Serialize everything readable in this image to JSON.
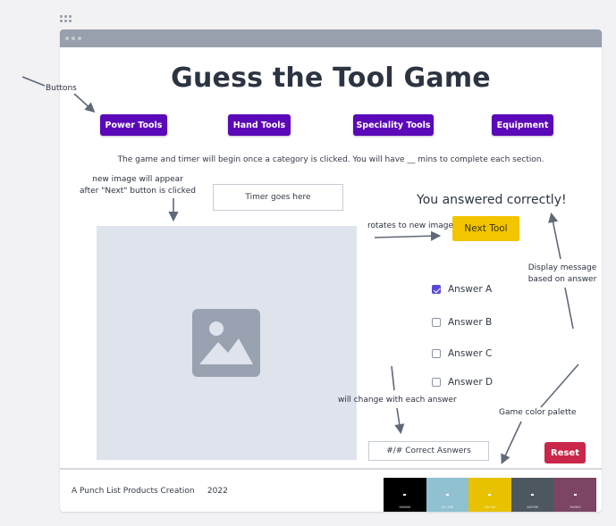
{
  "game": {
    "title": "Guess the Tool Game",
    "categories": [
      "Power Tools",
      "Hand Tools",
      "Speciality Tools",
      "Equipment"
    ],
    "instructions": "The game and timer will begin once a category is clicked. You will have __ mins to complete each section.",
    "timer_placeholder": "Timer goes here",
    "feedback_message": "You answered correctly!",
    "next_button": "Next Tool",
    "answers": [
      {
        "label": "Answer A",
        "checked": true
      },
      {
        "label": "Answer B",
        "checked": false
      },
      {
        "label": "Answer C",
        "checked": false
      },
      {
        "label": "Answer D",
        "checked": false
      }
    ],
    "score_text": "#/# Correct Asnwers",
    "reset_button": "Reset",
    "image_placeholder_icon": "image-placeholder-icon"
  },
  "footer": {
    "credit": "A Punch List Products Creation",
    "year": "2022",
    "palette": [
      {
        "color": "#000000",
        "label": "000000"
      },
      {
        "color": "#8fc1d0",
        "label": "8fc1d0"
      },
      {
        "color": "#e8c100",
        "label": "e8c100"
      },
      {
        "color": "#4d5760",
        "label": "4d5760"
      },
      {
        "color": "#7b4563",
        "label": "7b4563"
      }
    ]
  },
  "annotations": {
    "buttons": "Buttons",
    "new_image_line1": "new image will appear",
    "new_image_line2": "after \"Next\" button is clicked",
    "rotates": "rotates to new image",
    "display_line1": "Display message",
    "display_line2": "based on answer",
    "will_change": "will change with each answer",
    "palette": "Game color palette"
  },
  "colors": {
    "category_button": "#5b08b8",
    "next_button": "#f2c500",
    "reset_button": "#c9274a",
    "checkbox_checked": "#5a4ad6",
    "titlebar": "#97a0ac"
  }
}
